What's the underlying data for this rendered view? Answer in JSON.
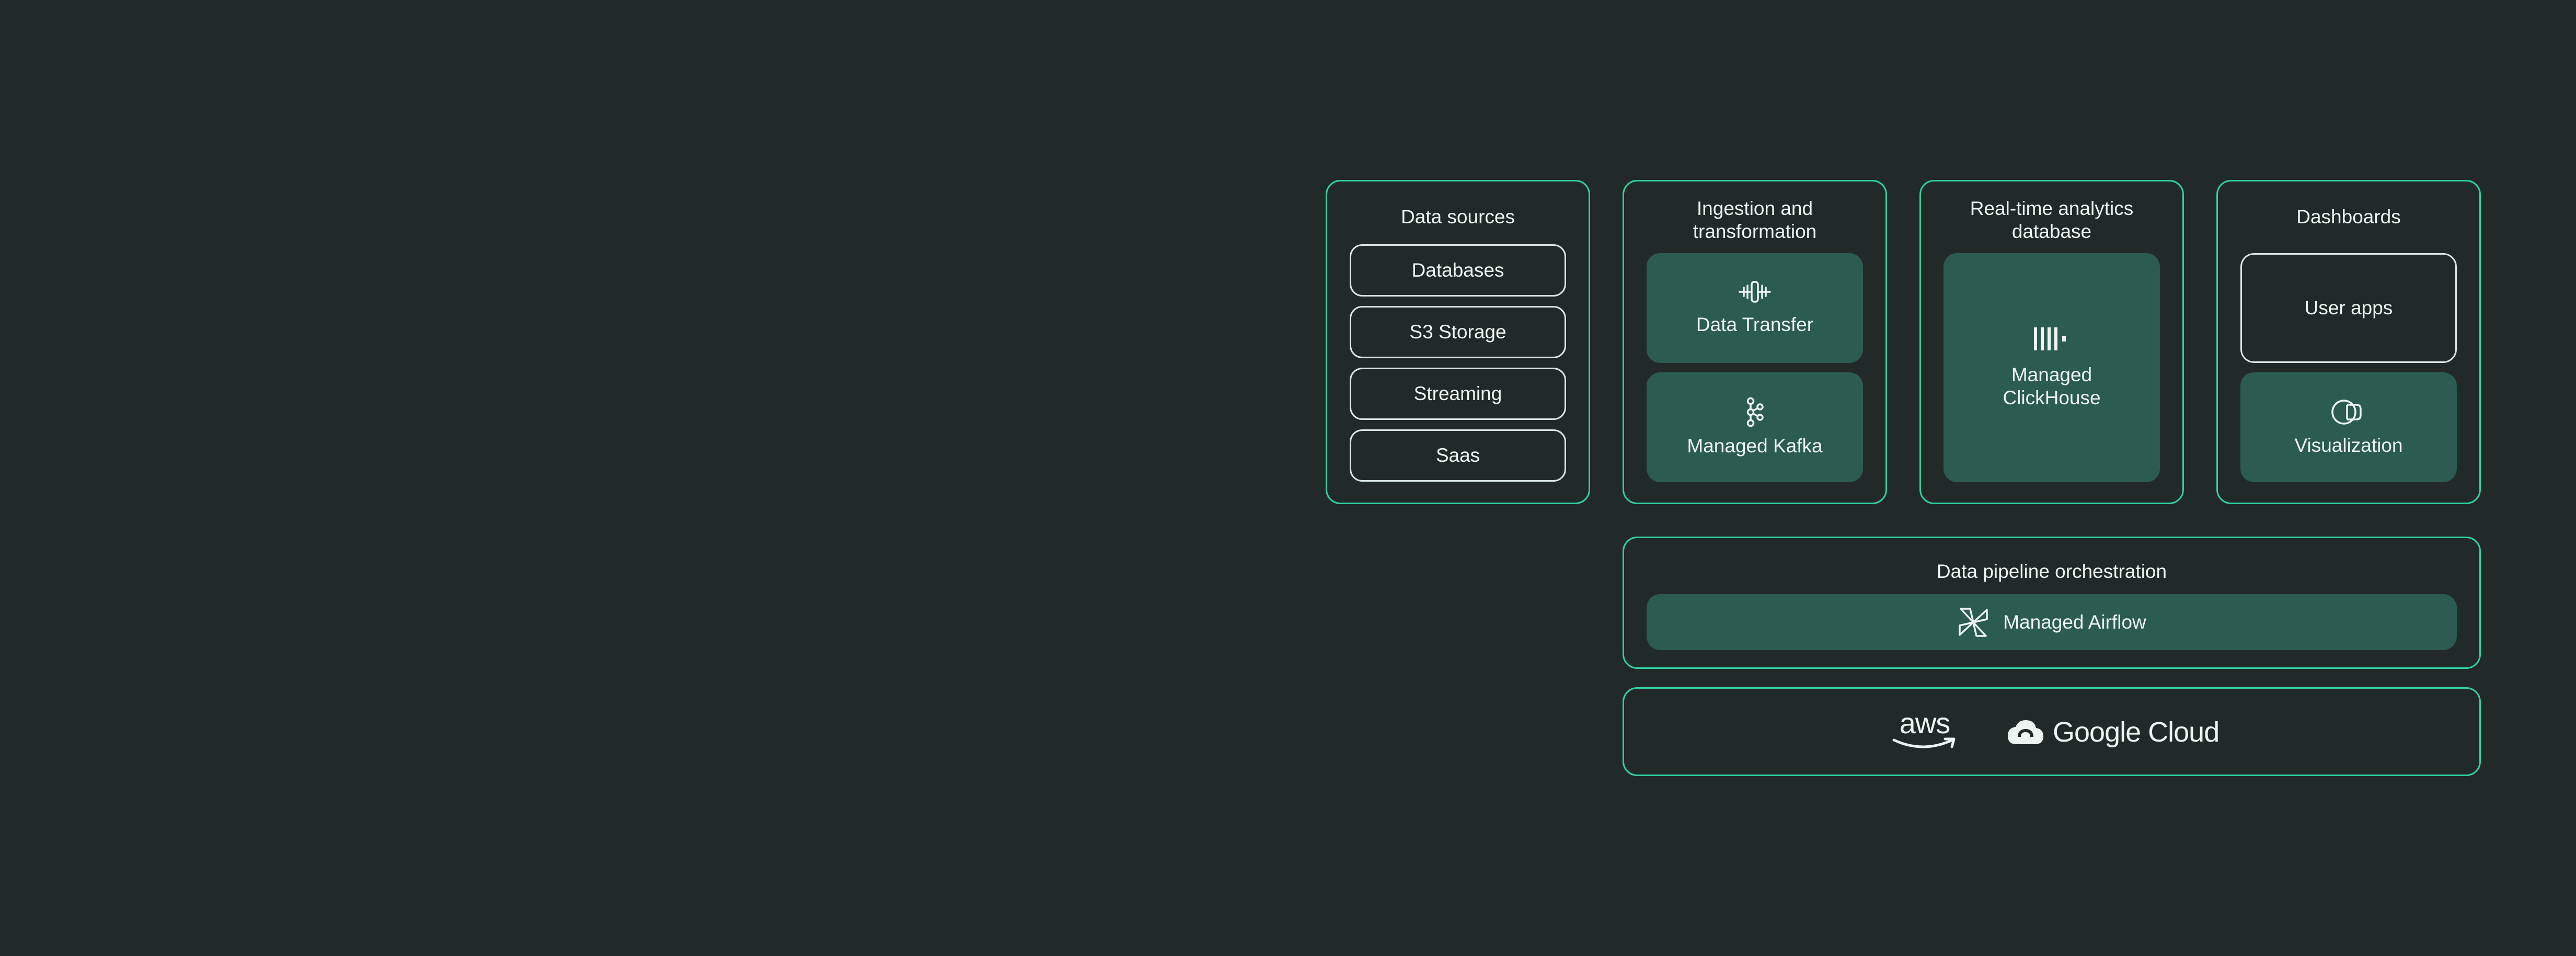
{
  "columns": {
    "data_sources": {
      "title": "Data sources",
      "items": [
        "Databases",
        "S3 Storage",
        "Streaming",
        "Saas"
      ]
    },
    "ingestion": {
      "title_line1": "Ingestion and",
      "title_line2": "transformation",
      "tiles": [
        {
          "label": "Data Transfer",
          "icon": "data-transfer-icon"
        },
        {
          "label": "Managed Kafka",
          "icon": "kafka-icon"
        }
      ]
    },
    "analytics": {
      "title_line1": "Real-time analytics",
      "title_line2": "database",
      "tile": {
        "label_line1": "Managed",
        "label_line2": "ClickHouse",
        "icon": "clickhouse-icon"
      }
    },
    "dashboards": {
      "title": "Dashboards",
      "user_apps": "User apps",
      "visualization": {
        "label": "Visualization",
        "icon": "visualization-icon"
      }
    }
  },
  "orchestration": {
    "title": "Data pipeline orchestration",
    "airflow": {
      "label": "Managed Airflow",
      "icon": "airflow-icon"
    }
  },
  "clouds": {
    "aws": "aws",
    "google": "Google Cloud"
  },
  "colors": {
    "background": "#222a29",
    "accent_border": "#2fd1a4",
    "tile_fill": "#2b5b51",
    "text": "#eef4f2"
  }
}
